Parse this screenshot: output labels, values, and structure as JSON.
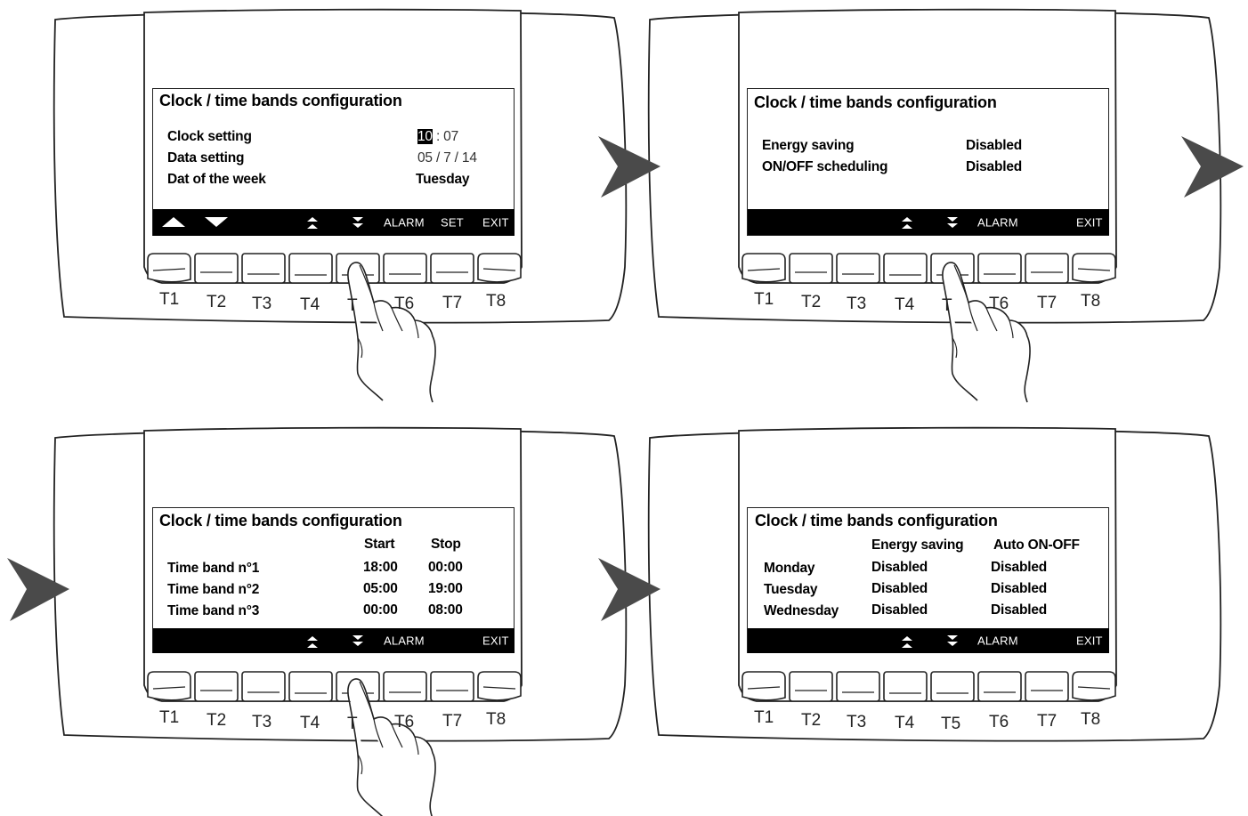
{
  "panels": [
    {
      "screen_title": "Clock / time bands configuration",
      "rows": [
        {
          "label": "Clock setting",
          "value_highlight": "10",
          "value_rest": " : 07"
        },
        {
          "label": "Data setting",
          "value": "05 / 7 / 14"
        },
        {
          "label": "Dat of the week",
          "value": "Tuesday"
        }
      ],
      "bar": [
        "up-arrow-icon",
        "down-arrow-icon",
        "page-up-icon",
        "page-down-icon",
        "ALARM",
        "SET",
        "EXIT"
      ],
      "keys": [
        "T1",
        "T2",
        "T3",
        "T4",
        "T5",
        "T6",
        "T7",
        "T8"
      ],
      "pressed_key": "T5"
    },
    {
      "screen_title": "Clock / time bands configuration",
      "rows": [
        {
          "label": "Energy saving",
          "value": "Disabled"
        },
        {
          "label": "ON/OFF scheduling",
          "value": "Disabled"
        }
      ],
      "bar": [
        "page-up-icon",
        "page-down-icon",
        "ALARM",
        "EXIT"
      ],
      "keys": [
        "T1",
        "T2",
        "T3",
        "T4",
        "T5",
        "T6",
        "T7",
        "T8"
      ],
      "pressed_key": "T5"
    },
    {
      "screen_title": "Clock / time bands configuration",
      "columns": [
        "Start",
        "Stop"
      ],
      "rows": [
        {
          "label": "Time band n°1",
          "start": "18:00",
          "stop": "00:00"
        },
        {
          "label": "Time band n°2",
          "start": "05:00",
          "stop": "19:00"
        },
        {
          "label": "Time band n°3",
          "start": "00:00",
          "stop": "08:00"
        }
      ],
      "bar": [
        "page-up-icon",
        "page-down-icon",
        "ALARM",
        "EXIT"
      ],
      "keys": [
        "T1",
        "T2",
        "T3",
        "T4",
        "T5",
        "T6",
        "T7",
        "T8"
      ],
      "pressed_key": "T5"
    },
    {
      "screen_title": "Clock / time bands configuration",
      "columns": [
        "Energy saving",
        "Auto ON-OFF"
      ],
      "rows": [
        {
          "label": "Monday",
          "energy": "Disabled",
          "auto": "Disabled"
        },
        {
          "label": "Tuesday",
          "energy": "Disabled",
          "auto": "Disabled"
        },
        {
          "label": "Wednesday",
          "energy": "Disabled",
          "auto": "Disabled"
        }
      ],
      "bar": [
        "page-up-icon",
        "page-down-icon",
        "ALARM",
        "EXIT"
      ],
      "keys": [
        "T1",
        "T2",
        "T3",
        "T4",
        "T5",
        "T6",
        "T7",
        "T8"
      ]
    }
  ],
  "flow_arrows": [
    "arrow-right-icon",
    "arrow-right-icon",
    "arrow-right-icon",
    "arrow-right-icon"
  ],
  "colors": {
    "bar": "#000000",
    "outline": "#222222",
    "arrow": "#4a4a4a"
  }
}
